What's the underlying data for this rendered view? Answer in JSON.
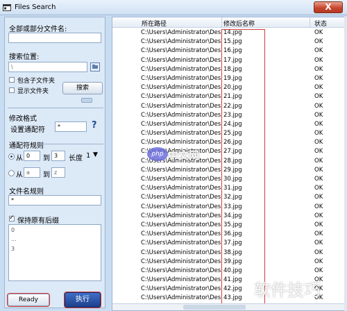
{
  "window": {
    "title": "Files Search",
    "close_label": "X"
  },
  "form": {
    "filename_label": "全部或部分文件名:",
    "filename_value": "",
    "location_label": "搜索位置:",
    "location_value": "\\",
    "include_subfolders_label": "包含子文件夹",
    "show_folders_label": "显示文件夹",
    "search_button": "搜索",
    "edit_format_label": "修改格式",
    "wildcard_setting_label": "设置通配符",
    "wildcard_value": "*",
    "help_label": "?",
    "wildcard_rule_label": "通配符规则",
    "from_label": "从",
    "to_label": "到",
    "from1_value": "0",
    "to1_value": "3",
    "length_label": "长度",
    "length_value": "1",
    "from2_value": "a",
    "to2_value": "z",
    "name_rule_label": "文件名规则",
    "name_rule_value": "*",
    "keep_extension_label": "保持原有后缀",
    "preview_lines": [
      "0",
      "...",
      "3"
    ],
    "status_button": "Ready",
    "execute_button": "执行"
  },
  "list": {
    "columns": [
      "所在路径",
      "修改后名称",
      "状态"
    ],
    "rows": [
      {
        "path": "C:\\Users\\Administrator\\Desktop",
        "name": "14.jpg",
        "status": "OK"
      },
      {
        "path": "C:\\Users\\Administrator\\Desktop",
        "name": "15.jpg",
        "status": "OK"
      },
      {
        "path": "C:\\Users\\Administrator\\Desktop",
        "name": "16.jpg",
        "status": "OK"
      },
      {
        "path": "C:\\Users\\Administrator\\Desktop",
        "name": "17.jpg",
        "status": "OK"
      },
      {
        "path": "C:\\Users\\Administrator\\Desktop",
        "name": "18.jpg",
        "status": "OK"
      },
      {
        "path": "C:\\Users\\Administrator\\Desktop",
        "name": "19.jpg",
        "status": "OK"
      },
      {
        "path": "C:\\Users\\Administrator\\Desktop",
        "name": "20.jpg",
        "status": "OK"
      },
      {
        "path": "C:\\Users\\Administrator\\Desktop",
        "name": "21.jpg",
        "status": "OK"
      },
      {
        "path": "C:\\Users\\Administrator\\Desktop",
        "name": "22.jpg",
        "status": "OK"
      },
      {
        "path": "C:\\Users\\Administrator\\Desktop",
        "name": "23.jpg",
        "status": "OK"
      },
      {
        "path": "C:\\Users\\Administrator\\Desktop",
        "name": "24.jpg",
        "status": "OK"
      },
      {
        "path": "C:\\Users\\Administrator\\Desktop",
        "name": "25.jpg",
        "status": "OK"
      },
      {
        "path": "C:\\Users\\Administrator\\Desktop",
        "name": "26.jpg",
        "status": "OK"
      },
      {
        "path": "C:\\Users\\Administrator\\Desktop",
        "name": "27.jpg",
        "status": "OK"
      },
      {
        "path": "C:\\Users\\Administrator\\Desktop",
        "name": "28.jpg",
        "status": "OK"
      },
      {
        "path": "C:\\Users\\Administrator\\Desktop",
        "name": "29.jpg",
        "status": "OK"
      },
      {
        "path": "C:\\Users\\Administrator\\Desktop",
        "name": "30.jpg",
        "status": "OK"
      },
      {
        "path": "C:\\Users\\Administrator\\Desktop",
        "name": "31.jpg",
        "status": "OK"
      },
      {
        "path": "C:\\Users\\Administrator\\Desktop",
        "name": "32.jpg",
        "status": "OK"
      },
      {
        "path": "C:\\Users\\Administrator\\Desktop",
        "name": "33.jpg",
        "status": "OK"
      },
      {
        "path": "C:\\Users\\Administrator\\Desktop",
        "name": "34.jpg",
        "status": "OK"
      },
      {
        "path": "C:\\Users\\Administrator\\Desktop",
        "name": "35.jpg",
        "status": "OK"
      },
      {
        "path": "C:\\Users\\Administrator\\Desktop",
        "name": "36.jpg",
        "status": "OK"
      },
      {
        "path": "C:\\Users\\Administrator\\Desktop",
        "name": "37.jpg",
        "status": "OK"
      },
      {
        "path": "C:\\Users\\Administrator\\Desktop",
        "name": "38.jpg",
        "status": "OK"
      },
      {
        "path": "C:\\Users\\Administrator\\Desktop",
        "name": "39.jpg",
        "status": "OK"
      },
      {
        "path": "C:\\Users\\Administrator\\Desktop",
        "name": "40.jpg",
        "status": "OK"
      },
      {
        "path": "C:\\Users\\Administrator\\Desktop",
        "name": "41.jpg",
        "status": "OK"
      },
      {
        "path": "C:\\Users\\Administrator\\Desktop",
        "name": "42.jpg",
        "status": "OK"
      },
      {
        "path": "C:\\Users\\Administrator\\Desktop",
        "name": "43.jpg",
        "status": "OK"
      }
    ]
  },
  "watermark": {
    "badge": "php",
    "center_text": "中文网",
    "corner_text": "软件技巧"
  },
  "icons": {
    "app": "app-window-icon",
    "folder_browse": "folder-browse-icon",
    "help": "help-icon",
    "dropdown": "chevron-down-icon"
  },
  "colors": {
    "highlight_border": "#d43b3b",
    "panel_bg": "#dce9f7",
    "accent": "#1d4a93"
  }
}
